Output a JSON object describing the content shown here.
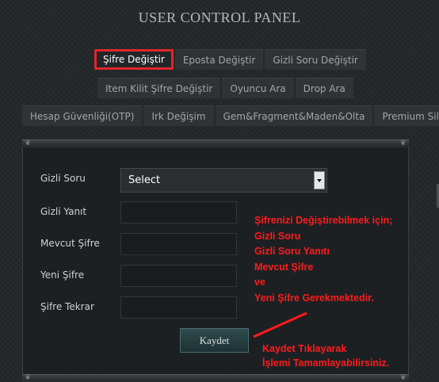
{
  "page": {
    "title": "USER CONTROL PANEL"
  },
  "tabs": {
    "row1": [
      {
        "label": "Şifre Değiştir",
        "active": true
      },
      {
        "label": "Eposta Değiştir",
        "active": false
      },
      {
        "label": "Gizli Soru Değiştir",
        "active": false
      }
    ],
    "row2": [
      {
        "label": "Item Kilit Şifre Değiştir"
      },
      {
        "label": "Oyuncu Ara"
      },
      {
        "label": "Drop Ara"
      }
    ],
    "row3": [
      {
        "label": "Hesap Güvenliği(OTP)"
      },
      {
        "label": "Irk Değişim"
      },
      {
        "label": "Gem&Fragment&Maden&Olta"
      },
      {
        "label": "Premium Sil"
      }
    ]
  },
  "form": {
    "secret_question": {
      "label": "Gizli Soru",
      "value": "Select"
    },
    "secret_answer": {
      "label": "Gizli Yanıt",
      "value": ""
    },
    "current_password": {
      "label": "Mevcut Şifre",
      "value": ""
    },
    "new_password": {
      "label": "Yeni Şifre",
      "value": ""
    },
    "repeat_password": {
      "label": "Şifre Tekrar",
      "value": ""
    },
    "save_label": "Kaydet"
  },
  "annotations": {
    "requirements": [
      "Şifrenizi Değiştirebilmek için;",
      "Gizli Soru",
      "Gizli Soru Yanıtı",
      "Mevcut Şifre",
      "ve",
      "Yeni Şifre Gerekmektedir."
    ],
    "save_hint": [
      "Kaydet Tıklayarak",
      "İşlemi Tamamlayabilirsiniz."
    ],
    "color": "#ff1b1b"
  },
  "colors": {
    "background": "#24282b",
    "active_tab_border": "#e3262a"
  }
}
